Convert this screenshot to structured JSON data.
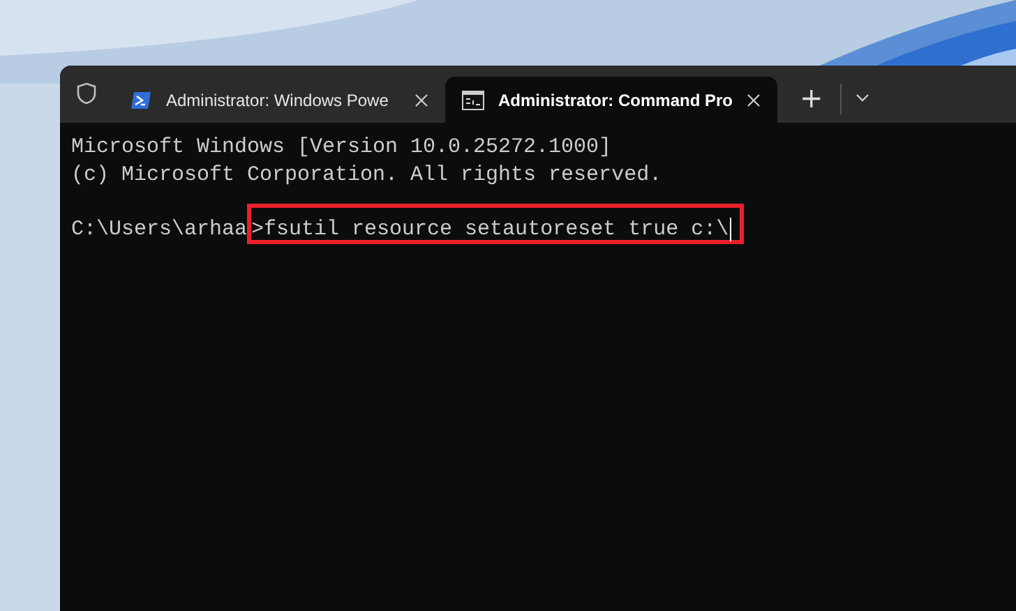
{
  "tabs": [
    {
      "title": "Administrator: Windows Powe",
      "kind": "powershell",
      "selected": false
    },
    {
      "title": "Administrator: Command Pro",
      "kind": "cmd",
      "selected": true
    }
  ],
  "new_tab": "+",
  "terminal": {
    "lines": [
      {
        "prompt": "Microsoft Windows [Version 10.0.25272.1000]"
      },
      {
        "prompt": "(c) Microsoft Corporation. All rights reserved."
      },
      {
        "kind": "blank"
      },
      {
        "prompt": "C:\\Users\\arhaa",
        "command": ">fsutil resource setautoreset true c:\\",
        "highlighted": true,
        "cursor": true
      }
    ]
  }
}
